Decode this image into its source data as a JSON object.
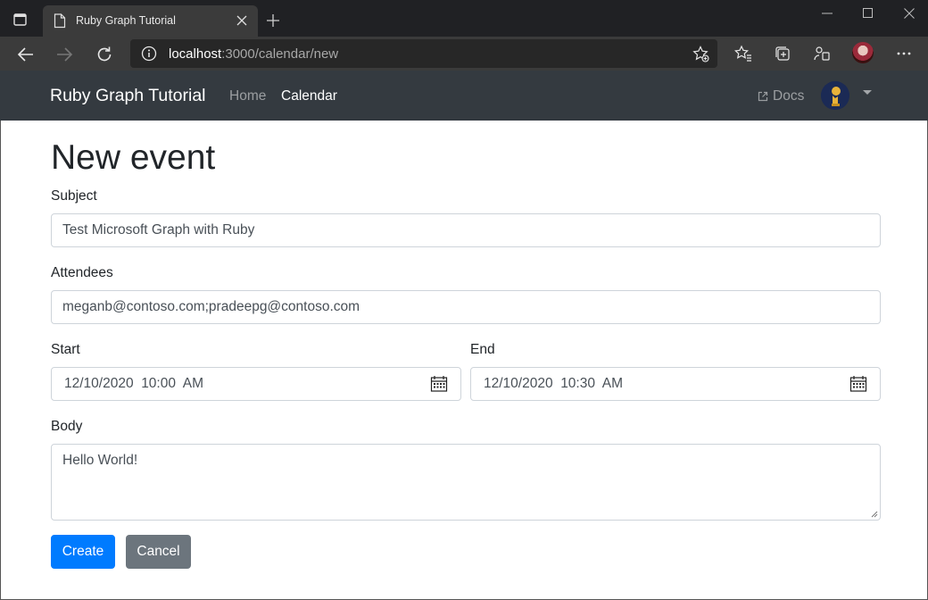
{
  "browser": {
    "tab_title": "Ruby Graph Tutorial",
    "url_host": "localhost",
    "url_path": ":3000/calendar/new"
  },
  "navbar": {
    "brand": "Ruby Graph Tutorial",
    "links": [
      "Home",
      "Calendar"
    ],
    "active_link": "Calendar",
    "docs_label": "Docs"
  },
  "form": {
    "heading": "New event",
    "subject_label": "Subject",
    "subject_value": "Test Microsoft Graph with Ruby",
    "attendees_label": "Attendees",
    "attendees_value": "meganb@contoso.com;pradeepg@contoso.com",
    "start_label": "Start",
    "start_value": "12/10/2020  10:00  AM",
    "end_label": "End",
    "end_value": "12/10/2020  10:30  AM",
    "body_label": "Body",
    "body_value": "Hello World!",
    "create_label": "Create",
    "cancel_label": "Cancel"
  },
  "colors": {
    "navbar_bg": "#343a40",
    "primary": "#007bff",
    "secondary": "#6c757d"
  }
}
